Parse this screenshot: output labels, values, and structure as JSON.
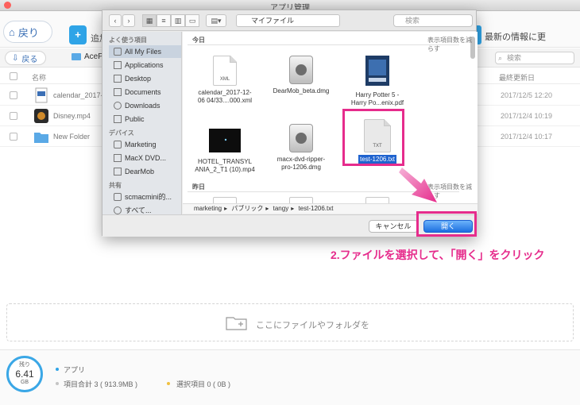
{
  "window": {
    "title": "アプリ管理"
  },
  "app_toolbar": {
    "back_label": "戻り",
    "add_label": "追加",
    "latest_label": "最新の情報に更"
  },
  "tabs": {
    "back_label": "戻る",
    "folder_label": "AcePl",
    "search_placeholder": "検索"
  },
  "columns": {
    "name": "名称",
    "date": "最終更新日"
  },
  "files": [
    {
      "name": "calendar_2017-12-0",
      "date": "2017/12/5  12:20"
    },
    {
      "name": "Disney.mp4",
      "date": "2017/12/4  10:19"
    },
    {
      "name": "New Folder",
      "date": "2017/12/4  10:17"
    }
  ],
  "drop_zone": {
    "label": "ここにファイルやフォルダを"
  },
  "status": {
    "storage_label": "残り",
    "storage_value": "6.41",
    "storage_unit": "GB",
    "apps_label": "アプリ",
    "total_label": "項目合計 3 ( 913.9MB )",
    "selected_label": "選択項目 0 ( 0B )"
  },
  "sheet": {
    "location": "マイファイル",
    "search_placeholder": "検索",
    "sidebar": {
      "favorites_title": "よく使う項目",
      "favorites": [
        "All My Files",
        "Applications",
        "Desktop",
        "Documents",
        "Downloads",
        "Public"
      ],
      "devices_title": "デバイス",
      "devices": [
        "Marketing",
        "MacX DVD...",
        "DearMob"
      ],
      "shared_title": "共有",
      "shared": [
        "scmacmini的...",
        "すべて..."
      ]
    },
    "group_today": "今日",
    "group_yesterday": "昨日",
    "reduce_items": "表示項目数を減らす",
    "tiles": [
      {
        "label1": "calendar_2017-12-",
        "label2": "06 04/33....000.xml",
        "ext": "XML"
      },
      {
        "label1": "DearMob_beta.dmg",
        "label2": ""
      },
      {
        "label1": "Harry Potter 5 -",
        "label2": "Harry Po...enix.pdf"
      },
      {
        "label1": "HOTEL_TRANSYL",
        "label2": "ANIA_2_T1 (10).mp4"
      },
      {
        "label1": "macx-dvd-ripper-",
        "label2": "pro-1206.dmg"
      },
      {
        "label1": "test-1206.txt",
        "label2": "",
        "ext": "TXT"
      }
    ],
    "path": [
      "marketing",
      "パブリック",
      "tangy",
      "test-1206.txt"
    ],
    "cancel_label": "キャンセル",
    "open_label": "開く"
  },
  "instruction": "2.ファイルを選択して、「開く」をクリック",
  "colors": {
    "accent": "#2fa4e7",
    "highlight": "#e62c8c",
    "primary_button": "#1c6fe0"
  }
}
